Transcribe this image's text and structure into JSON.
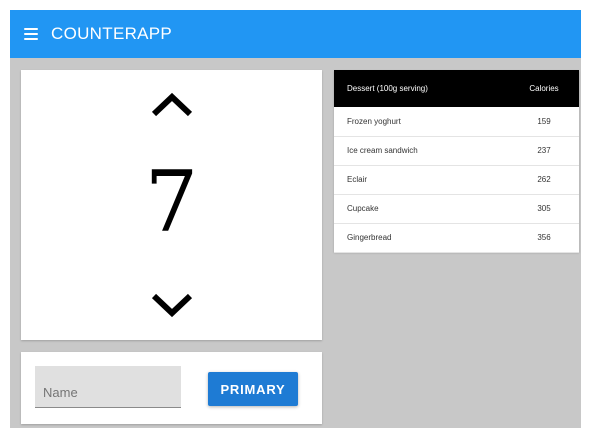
{
  "appbar": {
    "title": "COUNTERAPP",
    "background": "#2196f3",
    "menu_icon": "hamburger-menu-icon"
  },
  "counter": {
    "value": "7",
    "increment_icon": "chevron-up-icon",
    "decrement_icon": "chevron-down-icon"
  },
  "form": {
    "name_placeholder": "Name",
    "name_value": "",
    "button_label": "PRIMARY",
    "button_color": "#1e7bd4"
  },
  "table": {
    "columns": [
      "Dessert (100g serving)",
      "Calories"
    ],
    "rows": [
      {
        "dessert": "Frozen yoghurt",
        "calories": "159"
      },
      {
        "dessert": "Ice cream sandwich",
        "calories": "237"
      },
      {
        "dessert": "Eclair",
        "calories": "262"
      },
      {
        "dessert": "Cupcake",
        "calories": "305"
      },
      {
        "dessert": "Gingerbread",
        "calories": "356"
      }
    ]
  }
}
